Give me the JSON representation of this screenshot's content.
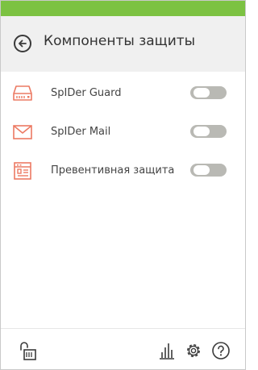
{
  "colors": {
    "topbar": "#7cc242",
    "accent": "#ec7a63",
    "toggle_off": "#b9b9b4",
    "icon_dark": "#3a3a3a"
  },
  "header": {
    "back_icon": "arrow-left-circle-icon",
    "title": "Компоненты защиты"
  },
  "components": [
    {
      "icon": "hard-drive-icon",
      "label": "SpIDer Guard",
      "enabled": false
    },
    {
      "icon": "envelope-icon",
      "label": "SpIDer Mail",
      "enabled": false
    },
    {
      "icon": "preventive-protection-icon",
      "label": "Превентивная защита",
      "enabled": false
    }
  ],
  "footer": {
    "left_icon": "unlocked-padlock-icon",
    "right_icons": [
      "bar-chart-icon",
      "gear-icon",
      "help-icon"
    ]
  }
}
